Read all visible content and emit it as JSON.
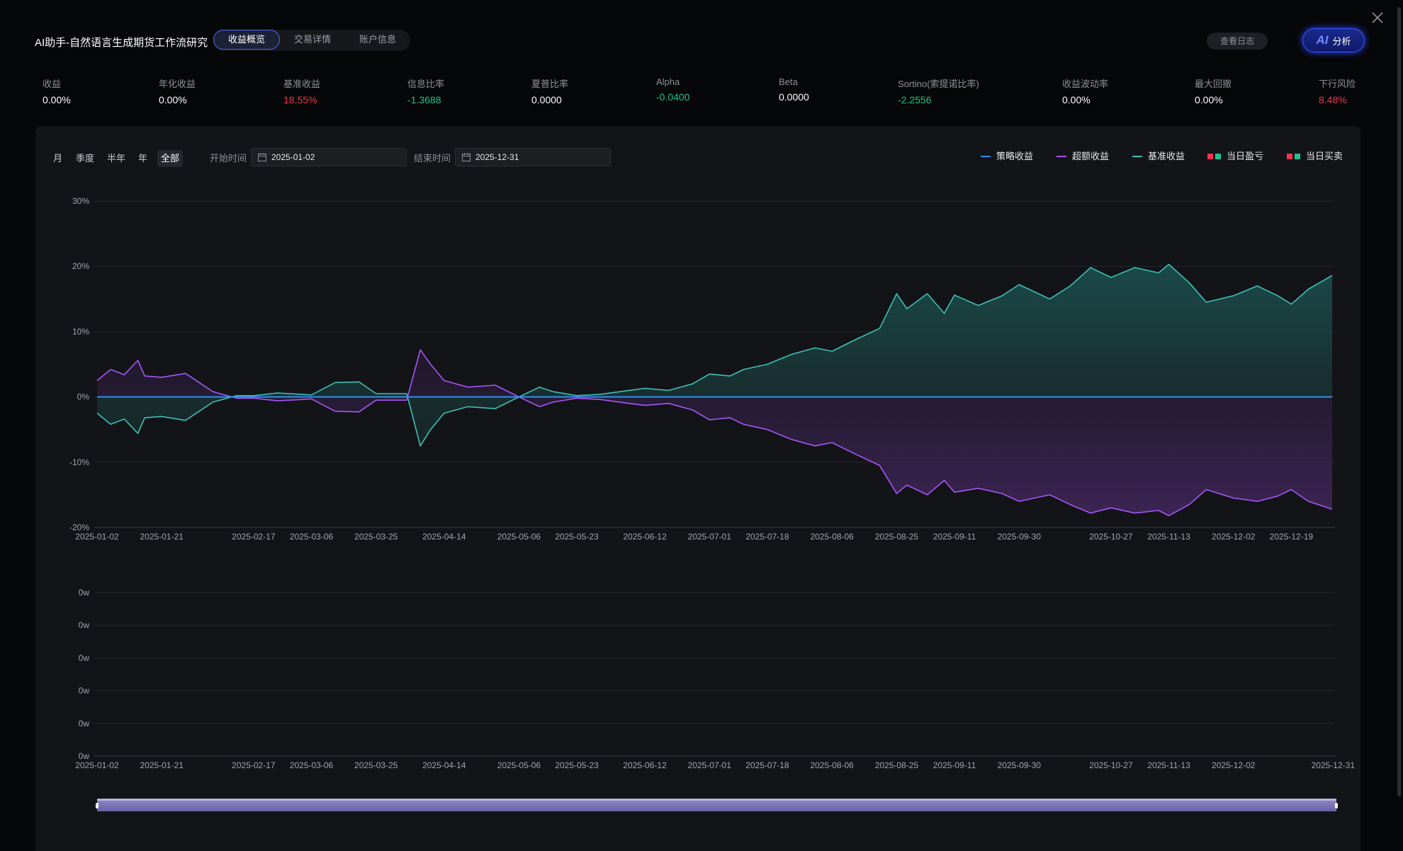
{
  "header": {
    "title": "AI助手-自然语言生成期货工作流研究",
    "tabs": [
      {
        "label": "收益概览",
        "active": true
      },
      {
        "label": "交易详情",
        "active": false
      },
      {
        "label": "账户信息",
        "active": false
      }
    ],
    "log_button": "查看日志",
    "ai_button_mark": "AI",
    "ai_button_label": "分析",
    "close_icon": "close-icon"
  },
  "metrics": [
    {
      "label": "收益",
      "value": "0.00%",
      "tone": "white"
    },
    {
      "label": "年化收益",
      "value": "0.00%",
      "tone": "white"
    },
    {
      "label": "基准收益",
      "value": "18.55%",
      "tone": "red"
    },
    {
      "label": "信息比率",
      "value": "-1.3688",
      "tone": "green"
    },
    {
      "label": "夏普比率",
      "value": "0.0000",
      "tone": "white"
    },
    {
      "label": "Alpha",
      "value": "-0.0400",
      "tone": "green"
    },
    {
      "label": "Beta",
      "value": "0.0000",
      "tone": "white"
    },
    {
      "label": "Sortino(索提诺比率)",
      "value": "-2.2556",
      "tone": "green"
    },
    {
      "label": "收益波动率",
      "value": "0.00%",
      "tone": "white"
    },
    {
      "label": "最大回撤",
      "value": "0.00%",
      "tone": "white"
    },
    {
      "label": "下行风险",
      "value": "8.48%",
      "tone": "red"
    }
  ],
  "filters": {
    "periods": [
      {
        "label": "月",
        "active": false
      },
      {
        "label": "季度",
        "active": false
      },
      {
        "label": "半年",
        "active": false
      },
      {
        "label": "年",
        "active": false
      },
      {
        "label": "全部",
        "active": true
      }
    ],
    "start_label": "开始时间",
    "start_value": "2025-01-02",
    "end_label": "结束时间",
    "end_value": "2025-12-31"
  },
  "legend": [
    {
      "label": "策略收益",
      "kind": "line",
      "color": "#2f8ff0"
    },
    {
      "label": "超额收益",
      "kind": "line",
      "color": "#a855f7"
    },
    {
      "label": "基准收益",
      "kind": "line",
      "color": "#3fbfb5"
    },
    {
      "label": "当日盈亏",
      "kind": "squares",
      "colors": [
        "#f0344f",
        "#23c08a"
      ]
    },
    {
      "label": "当日买卖",
      "kind": "squares",
      "colors": [
        "#f0344f",
        "#23c08a"
      ]
    }
  ],
  "colors": {
    "strategy": "#2f8ff0",
    "excess": "#a855f7",
    "benchmark": "#3fbfb5",
    "grid": "#26292f",
    "axis_text": "#a0a5ad",
    "slider_fill": "#7d74b8",
    "slider_bg": "#3b3760"
  },
  "chart_data": [
    {
      "type": "line",
      "title": "",
      "x_ticks": [
        "2025-01-02",
        "2025-01-21",
        "2025-02-17",
        "2025-03-06",
        "2025-03-25",
        "2025-04-14",
        "2025-05-06",
        "2025-05-23",
        "2025-06-12",
        "2025-07-01",
        "2025-07-18",
        "2025-08-06",
        "2025-08-25",
        "2025-09-11",
        "2025-09-30",
        "2025-10-27",
        "2025-11-13",
        "2025-12-02",
        "2025-12-19"
      ],
      "y_ticks": [
        "30%",
        "20%",
        "10%",
        "0%",
        "-10%",
        "-20%"
      ],
      "ylim": [
        -20,
        30
      ],
      "grid": true,
      "legend_position": "top-right",
      "series": [
        {
          "name": "策略收益",
          "color": "#2f8ff0",
          "fill": false,
          "points": [
            [
              "2025-01-02",
              0
            ],
            [
              "2025-12-31",
              0
            ]
          ]
        },
        {
          "name": "基准收益",
          "color": "#3fbfb5",
          "fill": true,
          "points": [
            [
              "2025-01-02",
              -2.5
            ],
            [
              "2025-01-06",
              -4.2
            ],
            [
              "2025-01-10",
              -3.4
            ],
            [
              "2025-01-14",
              -5.6
            ],
            [
              "2025-01-16",
              -3.2
            ],
            [
              "2025-01-21",
              -3.0
            ],
            [
              "2025-01-28",
              -3.6
            ],
            [
              "2025-02-05",
              -0.8
            ],
            [
              "2025-02-12",
              0.2
            ],
            [
              "2025-02-17",
              0.2
            ],
            [
              "2025-02-24",
              0.6
            ],
            [
              "2025-03-03",
              0.4
            ],
            [
              "2025-03-06",
              0.3
            ],
            [
              "2025-03-13",
              2.2
            ],
            [
              "2025-03-20",
              2.3
            ],
            [
              "2025-03-25",
              0.5
            ],
            [
              "2025-04-03",
              0.5
            ],
            [
              "2025-04-07",
              -7.5
            ],
            [
              "2025-04-10",
              -5.0
            ],
            [
              "2025-04-14",
              -2.5
            ],
            [
              "2025-04-21",
              -1.5
            ],
            [
              "2025-04-29",
              -1.8
            ],
            [
              "2025-05-06",
              0.0
            ],
            [
              "2025-05-12",
              1.5
            ],
            [
              "2025-05-16",
              0.8
            ],
            [
              "2025-05-23",
              0.2
            ],
            [
              "2025-05-30",
              0.4
            ],
            [
              "2025-06-06",
              0.9
            ],
            [
              "2025-06-12",
              1.3
            ],
            [
              "2025-06-19",
              1.0
            ],
            [
              "2025-06-26",
              2.0
            ],
            [
              "2025-07-01",
              3.5
            ],
            [
              "2025-07-07",
              3.2
            ],
            [
              "2025-07-11",
              4.2
            ],
            [
              "2025-07-18",
              5.0
            ],
            [
              "2025-07-25",
              6.5
            ],
            [
              "2025-08-01",
              7.5
            ],
            [
              "2025-08-06",
              7.0
            ],
            [
              "2025-08-13",
              8.8
            ],
            [
              "2025-08-20",
              10.5
            ],
            [
              "2025-08-25",
              15.8
            ],
            [
              "2025-08-28",
              13.5
            ],
            [
              "2025-09-03",
              15.8
            ],
            [
              "2025-09-08",
              12.8
            ],
            [
              "2025-09-11",
              15.6
            ],
            [
              "2025-09-18",
              14.0
            ],
            [
              "2025-09-25",
              15.5
            ],
            [
              "2025-09-30",
              17.2
            ],
            [
              "2025-10-09",
              15.0
            ],
            [
              "2025-10-15",
              17.0
            ],
            [
              "2025-10-21",
              19.8
            ],
            [
              "2025-10-27",
              18.3
            ],
            [
              "2025-11-03",
              19.8
            ],
            [
              "2025-11-10",
              19.0
            ],
            [
              "2025-11-13",
              20.3
            ],
            [
              "2025-11-19",
              17.5
            ],
            [
              "2025-11-24",
              14.5
            ],
            [
              "2025-12-02",
              15.5
            ],
            [
              "2025-12-09",
              17.0
            ],
            [
              "2025-12-15",
              15.5
            ],
            [
              "2025-12-19",
              14.2
            ],
            [
              "2025-12-24",
              16.5
            ],
            [
              "2025-12-31",
              18.6
            ]
          ]
        },
        {
          "name": "超额收益",
          "color": "#a855f7",
          "fill": true,
          "points": [
            [
              "2025-01-02",
              2.5
            ],
            [
              "2025-01-06",
              4.2
            ],
            [
              "2025-01-10",
              3.4
            ],
            [
              "2025-01-14",
              5.6
            ],
            [
              "2025-01-16",
              3.2
            ],
            [
              "2025-01-21",
              3.0
            ],
            [
              "2025-01-28",
              3.6
            ],
            [
              "2025-02-05",
              0.8
            ],
            [
              "2025-02-12",
              -0.2
            ],
            [
              "2025-02-17",
              -0.2
            ],
            [
              "2025-02-24",
              -0.6
            ],
            [
              "2025-03-03",
              -0.4
            ],
            [
              "2025-03-06",
              -0.3
            ],
            [
              "2025-03-13",
              -2.2
            ],
            [
              "2025-03-20",
              -2.3
            ],
            [
              "2025-03-25",
              -0.5
            ],
            [
              "2025-04-03",
              -0.5
            ],
            [
              "2025-04-07",
              7.2
            ],
            [
              "2025-04-10",
              5.0
            ],
            [
              "2025-04-14",
              2.5
            ],
            [
              "2025-04-21",
              1.5
            ],
            [
              "2025-04-29",
              1.8
            ],
            [
              "2025-05-06",
              0.0
            ],
            [
              "2025-05-12",
              -1.5
            ],
            [
              "2025-05-16",
              -0.8
            ],
            [
              "2025-05-23",
              -0.2
            ],
            [
              "2025-05-30",
              -0.4
            ],
            [
              "2025-06-06",
              -0.9
            ],
            [
              "2025-06-12",
              -1.3
            ],
            [
              "2025-06-19",
              -1.0
            ],
            [
              "2025-06-26",
              -2.0
            ],
            [
              "2025-07-01",
              -3.5
            ],
            [
              "2025-07-07",
              -3.2
            ],
            [
              "2025-07-11",
              -4.2
            ],
            [
              "2025-07-18",
              -5.0
            ],
            [
              "2025-07-25",
              -6.5
            ],
            [
              "2025-08-01",
              -7.5
            ],
            [
              "2025-08-06",
              -7.0
            ],
            [
              "2025-08-13",
              -8.8
            ],
            [
              "2025-08-20",
              -10.5
            ],
            [
              "2025-08-25",
              -14.8
            ],
            [
              "2025-08-28",
              -13.5
            ],
            [
              "2025-09-03",
              -15.0
            ],
            [
              "2025-09-08",
              -12.8
            ],
            [
              "2025-09-11",
              -14.6
            ],
            [
              "2025-09-18",
              -14.0
            ],
            [
              "2025-09-25",
              -14.8
            ],
            [
              "2025-09-30",
              -16.0
            ],
            [
              "2025-10-09",
              -15.0
            ],
            [
              "2025-10-15",
              -16.5
            ],
            [
              "2025-10-21",
              -17.8
            ],
            [
              "2025-10-27",
              -17.0
            ],
            [
              "2025-11-03",
              -17.8
            ],
            [
              "2025-11-10",
              -17.4
            ],
            [
              "2025-11-13",
              -18.2
            ],
            [
              "2025-11-19",
              -16.5
            ],
            [
              "2025-11-24",
              -14.2
            ],
            [
              "2025-12-02",
              -15.5
            ],
            [
              "2025-12-09",
              -16.0
            ],
            [
              "2025-12-15",
              -15.2
            ],
            [
              "2025-12-19",
              -14.2
            ],
            [
              "2025-12-24",
              -16.0
            ],
            [
              "2025-12-31",
              -17.2
            ]
          ]
        }
      ]
    },
    {
      "type": "bar",
      "title": "",
      "x_ticks": [
        "2025-01-02",
        "2025-01-21",
        "2025-02-17",
        "2025-03-06",
        "2025-03-25",
        "2025-04-14",
        "2025-05-06",
        "2025-05-23",
        "2025-06-12",
        "2025-07-01",
        "2025-07-18",
        "2025-08-06",
        "2025-08-25",
        "2025-09-11",
        "2025-09-30",
        "2025-10-27",
        "2025-11-13",
        "2025-12-02",
        "2025-12-31"
      ],
      "y_ticks": [
        "0w",
        "0w",
        "0w",
        "0w",
        "0w",
        "0w"
      ],
      "grid": true,
      "series": []
    }
  ],
  "zoom_slider": {
    "start": 0,
    "end": 1
  }
}
